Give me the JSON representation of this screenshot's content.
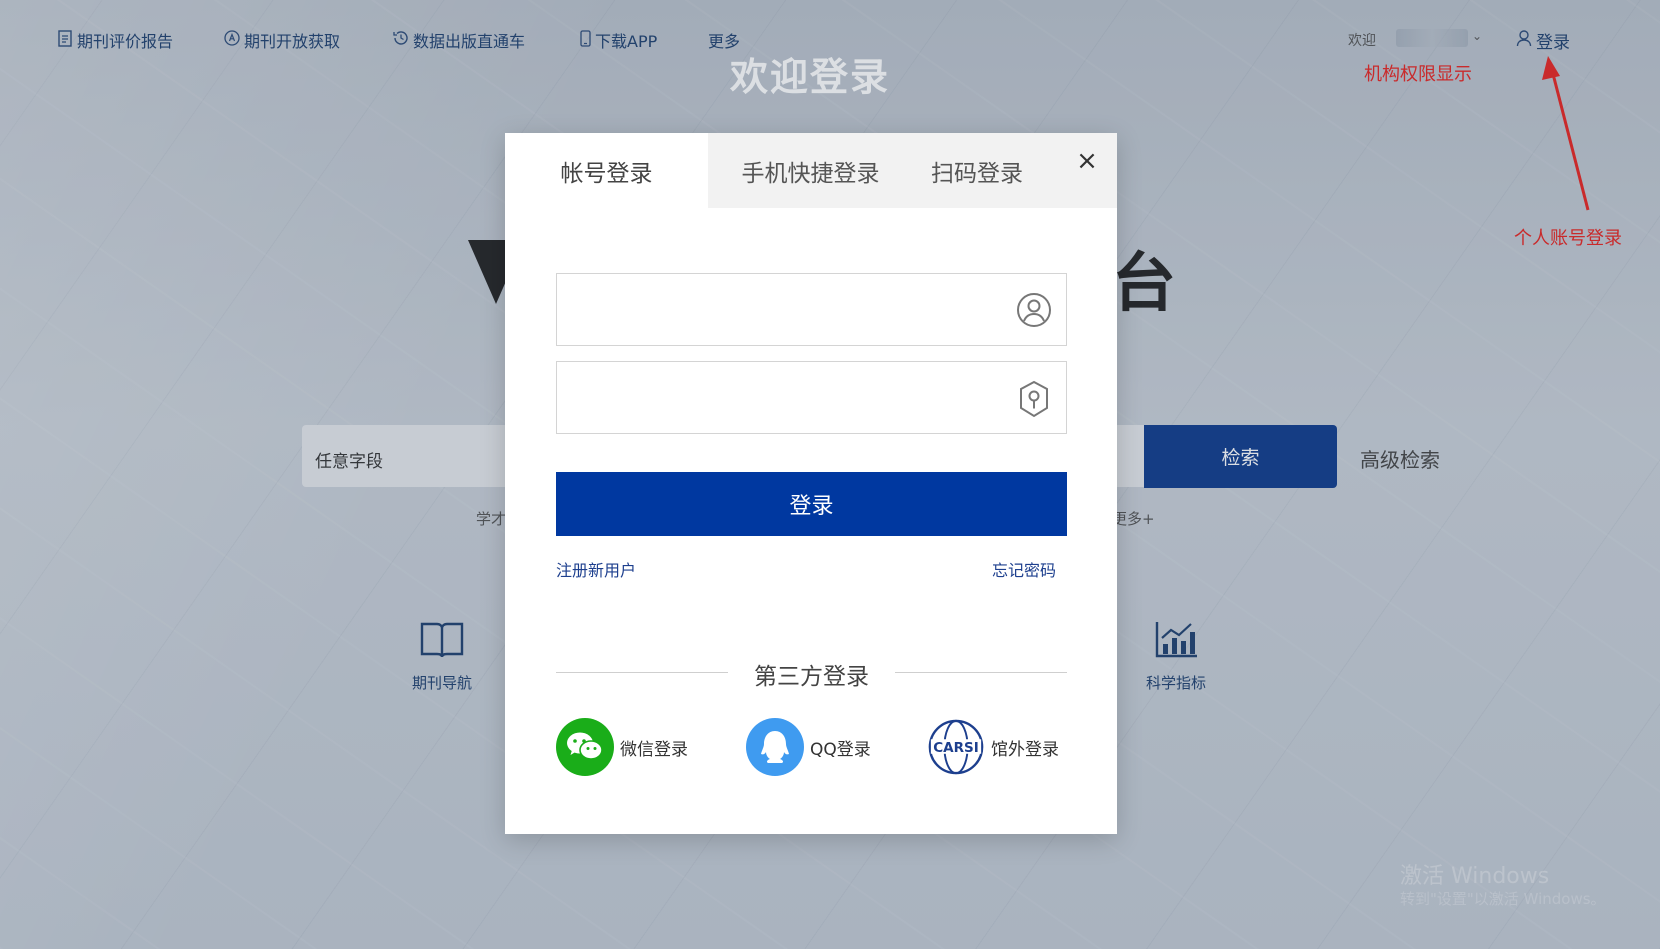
{
  "nav": {
    "items": [
      {
        "label": "期刊评价报告",
        "icon": "document-icon"
      },
      {
        "label": "期刊开放获取",
        "icon": "open-access-icon"
      },
      {
        "label": "数据出版直通车",
        "icon": "clock-history-icon"
      },
      {
        "label": "下载APP",
        "icon": "phone-icon"
      },
      {
        "label": "更多",
        "icon": ""
      }
    ],
    "welcome": "欢迎",
    "login": "登录"
  },
  "annotations": {
    "institution": "机构权限显示",
    "personal": "个人账号登录"
  },
  "page_title": "欢迎登录",
  "background": {
    "search_field": "任意字段",
    "search_button": "检索",
    "advanced_search": "高级检索",
    "hint_left": "学才",
    "hint_right": "更多+",
    "features": [
      {
        "label": "期刊导航",
        "icon": "book-icon"
      },
      {
        "label": "科学指标",
        "icon": "bar-chart-icon"
      }
    ],
    "title_fragment": "台"
  },
  "modal": {
    "tabs": [
      {
        "label": "帐号登录",
        "active": true
      },
      {
        "label": "手机快捷登录",
        "active": false
      },
      {
        "label": "扫码登录",
        "active": false
      }
    ],
    "close": "×",
    "username": {
      "value": "",
      "placeholder": ""
    },
    "password": {
      "value": "",
      "placeholder": ""
    },
    "submit": "登录",
    "register": "注册新用户",
    "forgot": "忘记密码",
    "third_party_title": "第三方登录",
    "social": [
      {
        "label": "微信登录",
        "icon": "wechat-icon",
        "color": "#1aad19"
      },
      {
        "label": "QQ登录",
        "icon": "qq-icon",
        "color": "#3f9bf0"
      },
      {
        "label": "馆外登录",
        "icon": "carsi-icon",
        "color": "#1d3f8e",
        "logo_text": "CARSI"
      }
    ]
  },
  "watermark": {
    "line1": "激活 Windows",
    "line2": "转到\"设置\"以激活 Windows。"
  },
  "colors": {
    "primary": "#0038a0",
    "search_button": "#0d3a8c",
    "annotation": "#e8231f",
    "link": "#1d3f8e"
  }
}
